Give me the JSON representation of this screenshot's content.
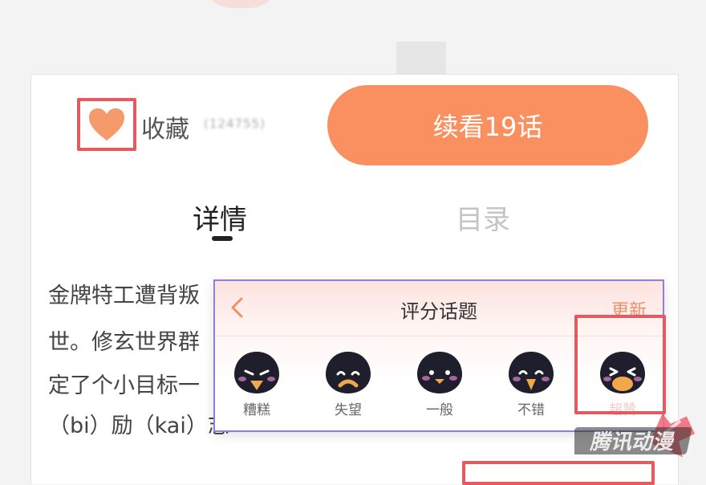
{
  "favorite": {
    "label": "收藏",
    "count": "(124755)",
    "icon": "heart-icon",
    "color": "#f59a6a"
  },
  "continue_button": {
    "label": "续看19话",
    "color": "#fa9060"
  },
  "tabs": [
    {
      "label": "详情",
      "active": true
    },
    {
      "label": "目录",
      "active": false
    }
  ],
  "description": {
    "lines": [
      "金牌特工遭背叛",
      "世。修玄世界群",
      "定了个小目标一",
      "（bi）励（kai）志"
    ]
  },
  "rating_panel": {
    "title": "评分话题",
    "update_label": "更新",
    "back_icon": "chevron-left-icon",
    "options": [
      {
        "label": "糟糕",
        "icon": "penguin-angry-icon"
      },
      {
        "label": "失望",
        "icon": "penguin-sad-icon"
      },
      {
        "label": "一般",
        "icon": "penguin-neutral-icon"
      },
      {
        "label": "不错",
        "icon": "penguin-happy-icon"
      },
      {
        "label": "超赞",
        "icon": "penguin-super-icon"
      }
    ]
  },
  "watermark": "腾讯动漫",
  "colors": {
    "accent": "#fa9060",
    "highlight": "#e45a5e",
    "panel_border": "#8f7fd6"
  }
}
